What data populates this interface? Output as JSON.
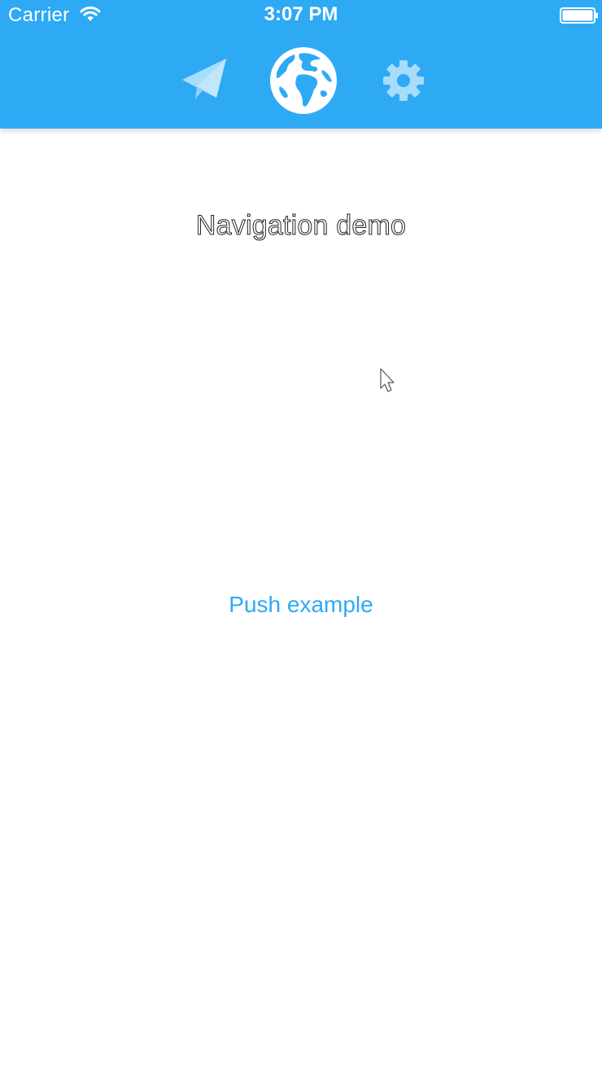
{
  "status_bar": {
    "carrier": "Carrier",
    "time": "3:07 PM"
  },
  "tab_bar": {
    "background_color": "#2eaaf5",
    "tabs": [
      {
        "icon": "paper-plane-icon",
        "selected": false
      },
      {
        "icon": "globe-icon",
        "selected": true
      },
      {
        "icon": "gear-icon",
        "selected": false
      }
    ]
  },
  "main": {
    "title": "Navigation demo",
    "push_button_label": "Push example",
    "accent_color": "#2eaaf5"
  }
}
